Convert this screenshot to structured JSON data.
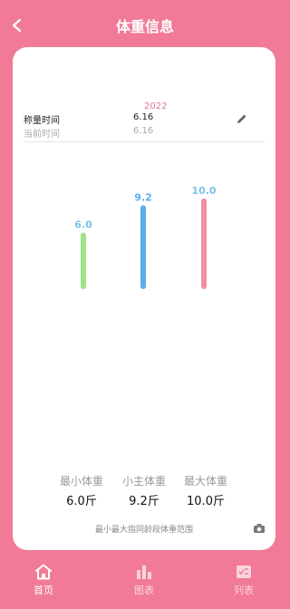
{
  "header": {
    "title": "体重信息"
  },
  "info": {
    "year": "2022",
    "weigh_time_label": "称量时间",
    "weigh_time_value": "6.16",
    "current_time_label": "当前时间",
    "current_time_value": "6.16"
  },
  "chart_data": {
    "type": "bar",
    "categories": [
      "最小",
      "小主",
      "最大"
    ],
    "values": [
      6.0,
      9.2,
      10.0
    ],
    "value_labels": [
      "6.0",
      "9.2",
      "10.0"
    ],
    "colors": [
      "#9ee28a",
      "#5aaee8",
      "#ef8fa3"
    ],
    "label_colors": [
      "#7cc1ea",
      "#5aaee8",
      "#7cc1ea"
    ],
    "ylim": [
      0,
      10.0
    ]
  },
  "stats": [
    {
      "title": "最小体重",
      "value": "6.0斤"
    },
    {
      "title": "小主体重",
      "value": "9.2斤"
    },
    {
      "title": "最大体重",
      "value": "10.0斤"
    }
  ],
  "footnote": "最小最大指同龄段体重范围",
  "tabs": [
    {
      "label": "首页",
      "icon": "home-icon",
      "active": true
    },
    {
      "label": "图表",
      "icon": "bar-chart-icon",
      "active": false
    },
    {
      "label": "列表",
      "icon": "checklist-icon",
      "active": false
    }
  ],
  "colors": {
    "background": "#f07a98",
    "card": "#ffffff"
  }
}
